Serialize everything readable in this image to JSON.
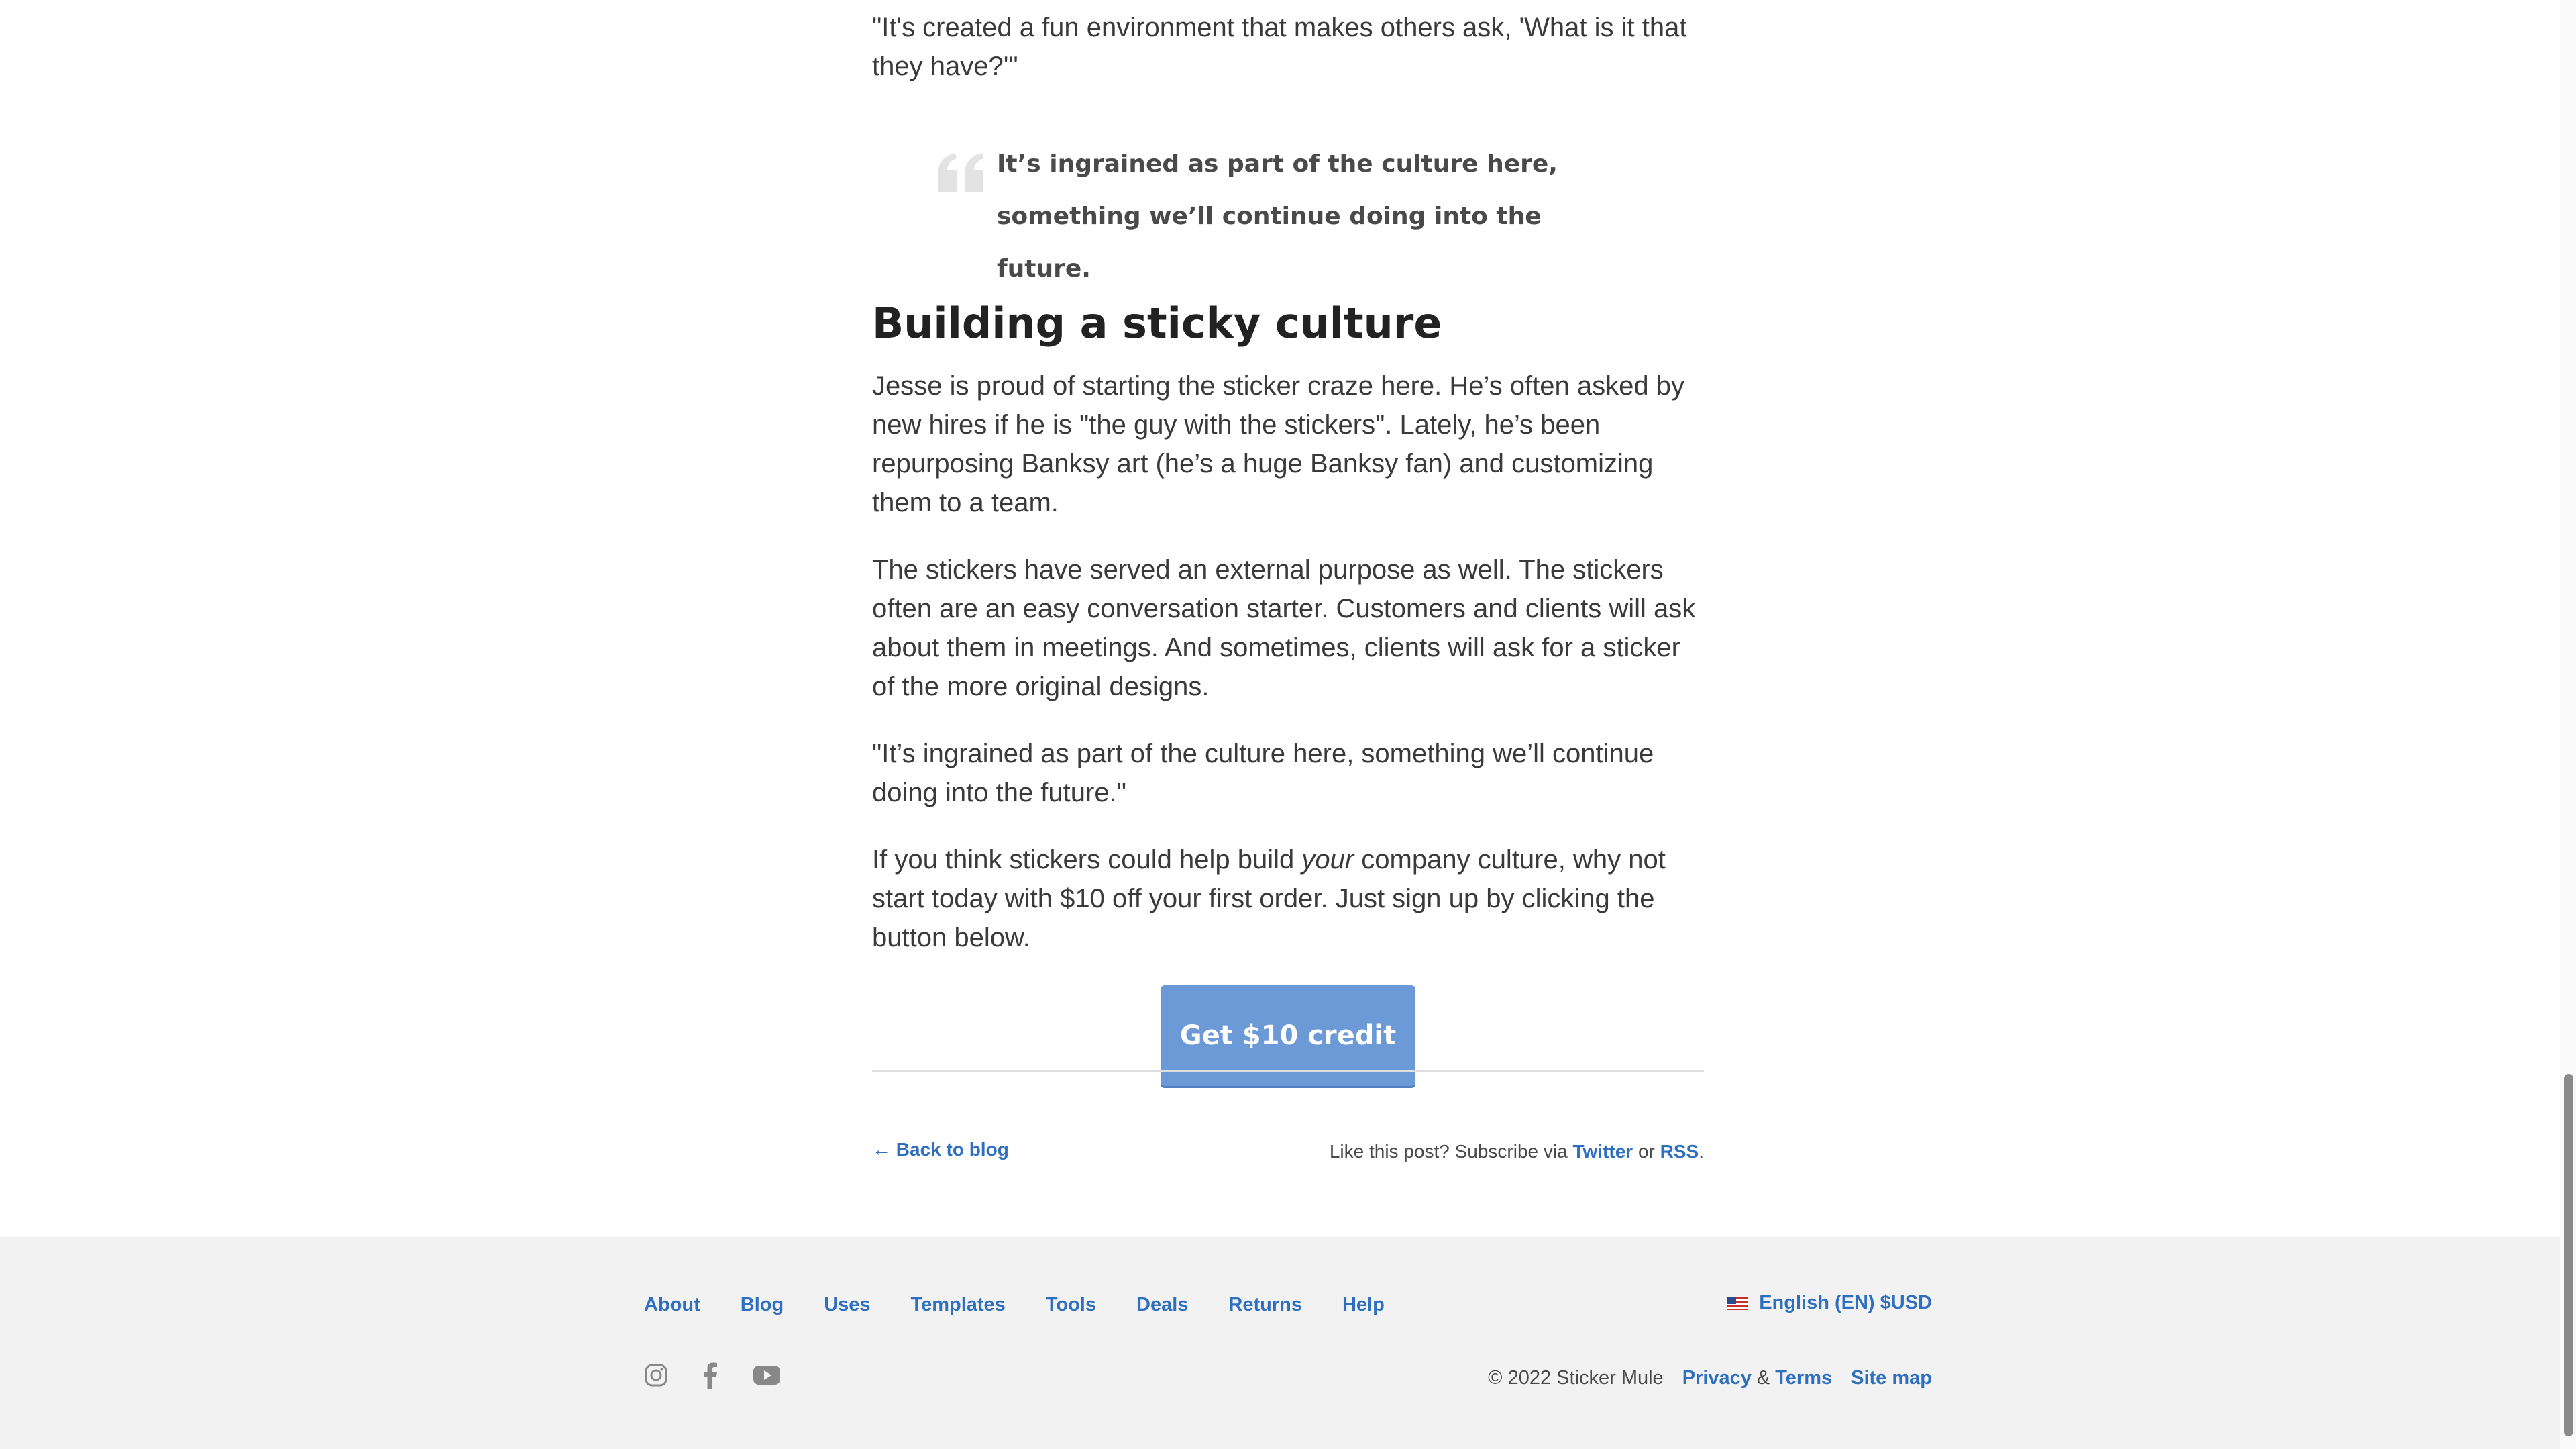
{
  "article": {
    "intro_quote": "\"It's created a fun environment that makes others ask, 'What is it that they have?'\"",
    "pullquote": "It’s ingrained as part of the culture here, something we’ll continue doing into the future.",
    "heading": "Building a sticky culture",
    "paragraphs": [
      "Jesse is proud of starting the sticker craze here. He’s often asked by new hires if he is \"the guy with the stickers\". Lately, he’s been repurposing Banksy art (he’s a huge Banksy fan) and customizing them to a team.",
      "The stickers have served an external purpose as well. The stickers often are an easy conversation starter. Customers and clients will ask about them in meetings. And sometimes, clients will ask for a sticker of the more original designs.",
      "\"It’s ingrained as part of the culture here, something we’ll continue doing into the future.\""
    ],
    "cta_paragraph": {
      "before": "If you think stickers could help build ",
      "emphasis": "your",
      "after": " company culture, why not start today with $10 off your first order. Just sign up by clicking the button below."
    },
    "cta_button": "Get $10 credit"
  },
  "post_footer": {
    "back_link": "← Back to blog",
    "subscribe_prefix": "Like this post? Subscribe via ",
    "twitter": "Twitter",
    "or": " or ",
    "rss": "RSS",
    "period": "."
  },
  "footer": {
    "nav": [
      "About",
      "Blog",
      "Uses",
      "Templates",
      "Tools",
      "Deals",
      "Returns",
      "Help"
    ],
    "language": "English (EN) $USD",
    "copyright": "© 2022 Sticker Mule",
    "privacy": "Privacy",
    "amp": "&",
    "terms": "Terms",
    "sitemap": "Site map",
    "social_icons": [
      "instagram-icon",
      "facebook-icon",
      "youtube-icon"
    ]
  },
  "colors": {
    "link": "#2f6fbf",
    "cta": "#6b9ad6",
    "footer_bg": "#f2f2f2"
  }
}
